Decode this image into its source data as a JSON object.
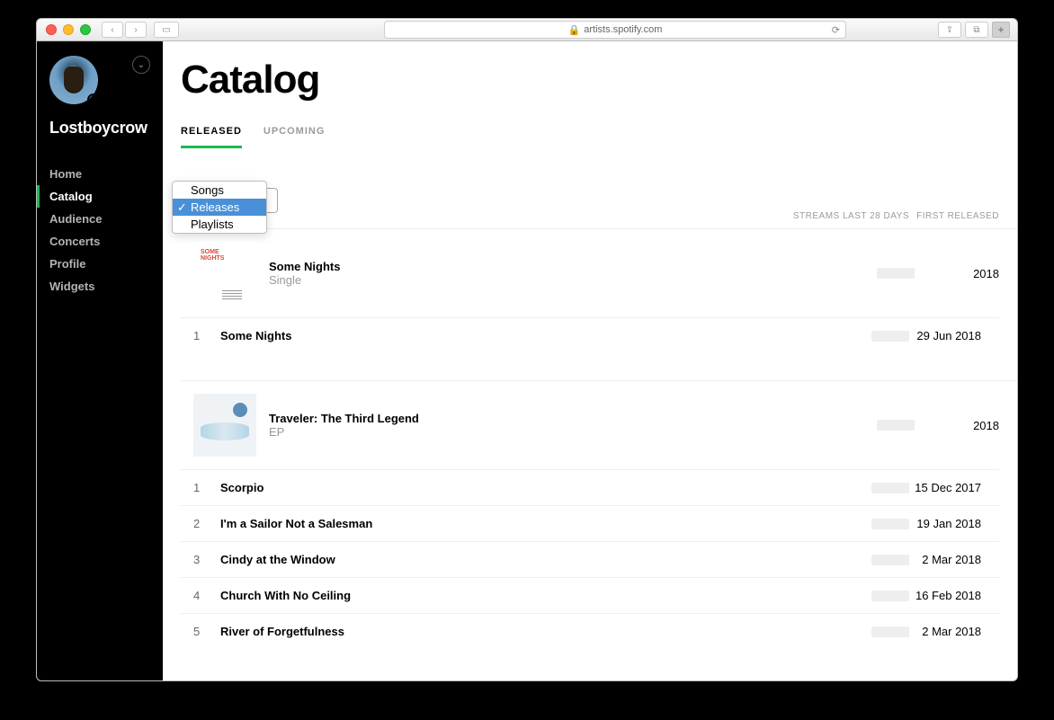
{
  "browser": {
    "url": "artists.spotify.com"
  },
  "sidebar": {
    "artist_name": "Lostboycrow",
    "items": [
      {
        "label": "Home"
      },
      {
        "label": "Catalog"
      },
      {
        "label": "Audience"
      },
      {
        "label": "Concerts"
      },
      {
        "label": "Profile"
      },
      {
        "label": "Widgets"
      }
    ]
  },
  "page": {
    "title": "Catalog",
    "tabs": [
      {
        "label": "RELEASED",
        "active": true
      },
      {
        "label": "UPCOMING",
        "active": false
      }
    ],
    "dropdown": {
      "options": [
        "Songs",
        "Releases",
        "Playlists"
      ],
      "selected": "Releases"
    },
    "columns": {
      "releases": "RELEASES",
      "streams": "STREAMS LAST 28 DAYS",
      "date": "FIRST RELEASED"
    }
  },
  "releases": [
    {
      "name": "Some Nights",
      "type": "Single",
      "year": "2018",
      "tracks": [
        {
          "num": "1",
          "name": "Some Nights",
          "date": "29 Jun 2018"
        }
      ]
    },
    {
      "name": "Traveler: The Third Legend",
      "type": "EP",
      "year": "2018",
      "tracks": [
        {
          "num": "1",
          "name": "Scorpio",
          "date": "15 Dec 2017"
        },
        {
          "num": "2",
          "name": "I'm a Sailor Not a Salesman",
          "date": "19 Jan 2018"
        },
        {
          "num": "3",
          "name": "Cindy at the Window",
          "date": "2 Mar 2018"
        },
        {
          "num": "4",
          "name": "Church With No Ceiling",
          "date": "16 Feb 2018"
        },
        {
          "num": "5",
          "name": "River of Forgetfulness",
          "date": "2 Mar 2018"
        }
      ]
    }
  ]
}
